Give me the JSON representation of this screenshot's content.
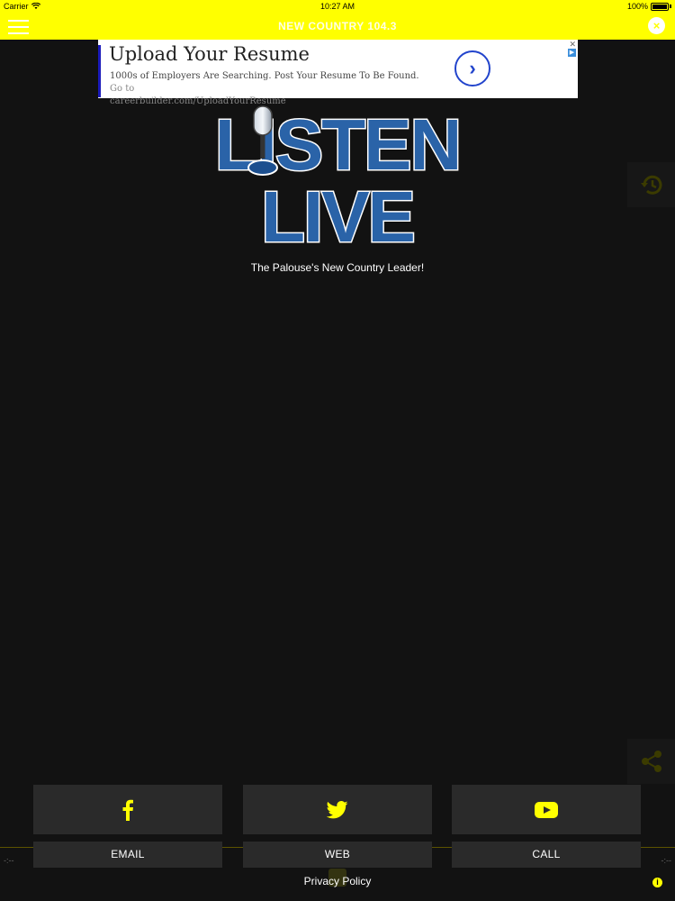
{
  "status_bar": {
    "carrier": "Carrier",
    "time": "10:27 AM",
    "battery": "100%"
  },
  "nav": {
    "title": "NEW COUNTRY 104.3"
  },
  "ad": {
    "title": "Upload Your Resume",
    "body": "1000s of Employers Are Searching. Post Your Resume To Be Found.",
    "goto": "Go to",
    "url": "careerbuilder.com/UploadYourResume"
  },
  "logo": {
    "line1": "LISTEN",
    "line2": "LIVE",
    "brand_color": "#2a63a8"
  },
  "tagline": "The Palouse's New Country Leader!",
  "actions": {
    "email": "EMAIL",
    "web": "WEB",
    "call": "CALL"
  },
  "social": [
    "facebook-icon",
    "twitter-icon",
    "youtube-icon"
  ],
  "footer": {
    "privacy": "Privacy Policy"
  },
  "colors": {
    "accent": "#ffff00",
    "background": "#121212",
    "button": "#2a2a2a"
  }
}
